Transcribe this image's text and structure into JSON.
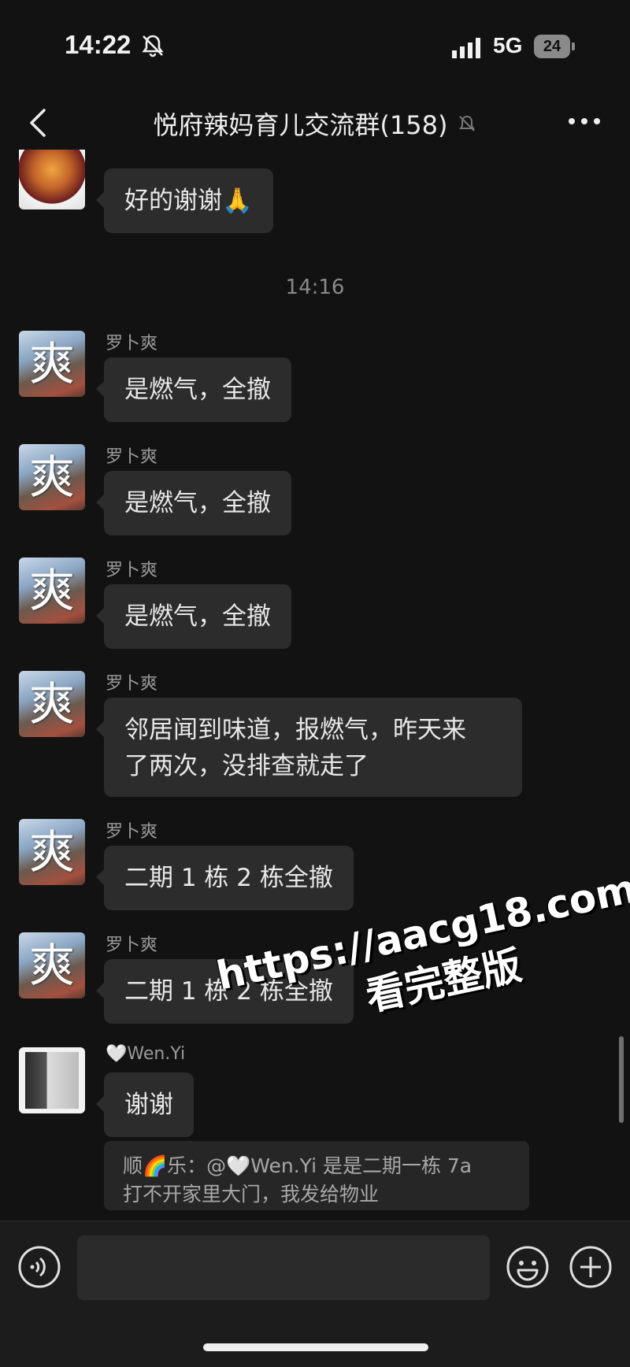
{
  "status_bar": {
    "time": "14:22",
    "network": "5G",
    "battery": "24",
    "icons": [
      "bell-off-icon",
      "signal-icon",
      "battery-icon"
    ]
  },
  "nav": {
    "title": "悦府辣妈育儿交流群(158)",
    "icons": [
      "back-icon",
      "bell-off-icon",
      "more-icon"
    ]
  },
  "messages": [
    {
      "sender": "",
      "text": "好的谢谢🙏"
    },
    {
      "timestamp": "14:16"
    },
    {
      "sender": "罗卜爽",
      "text": "是燃气，全撤"
    },
    {
      "sender": "罗卜爽",
      "text": "是燃气，全撤"
    },
    {
      "sender": "罗卜爽",
      "text": "是燃气，全撤"
    },
    {
      "sender": "罗卜爽",
      "text_line1": "邻居闻到味道，报燃气，昨天来",
      "text_line2": "了两次，没排查就走了"
    },
    {
      "sender": "罗卜爽",
      "text": "二期 1 栋 2 栋全撤"
    },
    {
      "sender": "罗卜爽",
      "text": "二期 1 栋 2 栋全撤"
    },
    {
      "sender": "🤍Wen.Yi",
      "text": "谢谢"
    }
  ],
  "quote": {
    "line1": "顺🌈乐：@🤍Wen.Yi 是是二期一栋 7a",
    "line2": "打不开家里大门，我发给物业"
  },
  "watermark": {
    "url": "https://aacg18.com",
    "sub": "看完整版"
  },
  "input_bar": {
    "icons": [
      "voice-icon",
      "emoji-icon",
      "plus-icon"
    ]
  },
  "avatar_glyph": "爽"
}
